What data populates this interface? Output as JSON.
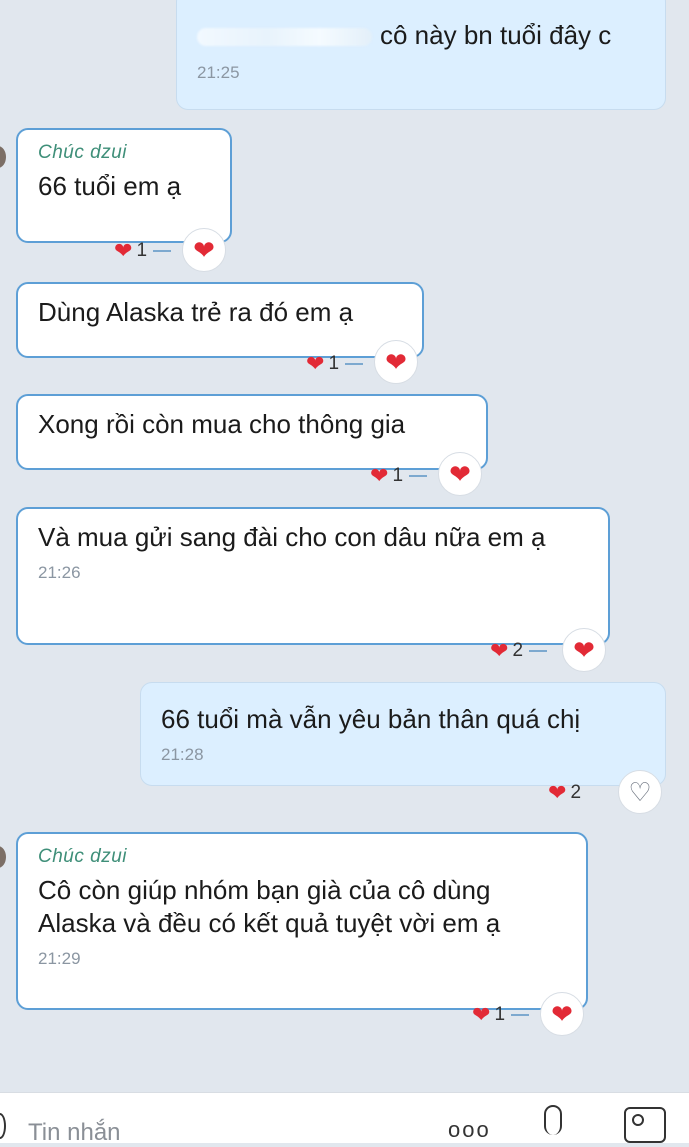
{
  "messages": {
    "m1": {
      "text": "cô này bn tuổi đây c",
      "time": "21:25"
    },
    "m2": {
      "sender": "Chúc dzui",
      "text": "66 tuổi em ạ",
      "reaction_count": "1"
    },
    "m3": {
      "text": "Dùng Alaska trẻ ra đó em ạ",
      "reaction_count": "1"
    },
    "m4": {
      "text": "Xong rồi còn mua cho thông gia",
      "reaction_count": "1"
    },
    "m5": {
      "text": "Và mua gửi sang đài cho con dâu nữa em ạ",
      "time": "21:26",
      "reaction_count": "2"
    },
    "m6": {
      "text": "66 tuổi mà vẫn yêu bản thân quá chị",
      "time": "21:28",
      "reaction_count": "2"
    },
    "m7": {
      "sender": "Chúc dzui",
      "text": "Cô còn giúp nhóm bạn già của cô dùng Alaska và đều có kết quả tuyệt vời em ạ",
      "time": "21:29",
      "reaction_count": "1"
    }
  },
  "composer": {
    "placeholder": "Tin nhắn",
    "more_icon": "ooo",
    "icons": [
      "more-icon",
      "microphone-icon",
      "image-icon"
    ]
  },
  "colors": {
    "heart": "#e22a36",
    "bubble_border": "#5d9fd6",
    "outgoing_bg": "#dcefff"
  }
}
